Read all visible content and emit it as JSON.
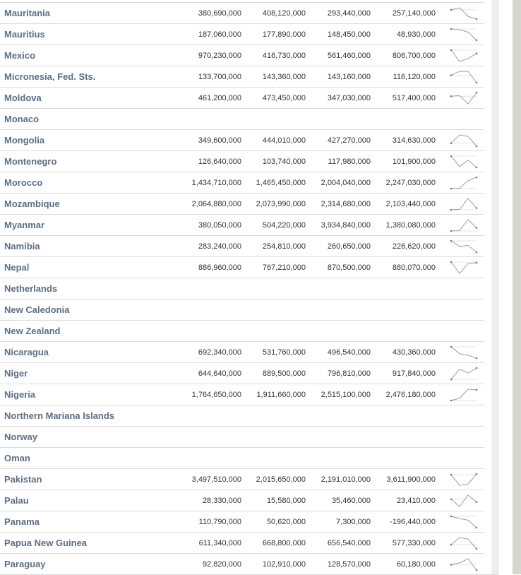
{
  "table": {
    "rows": [
      {
        "name": "Mauritania",
        "values": [
          "380,690,000",
          "408,120,000",
          "293,440,000",
          "257,140,000"
        ],
        "trend": [
          380690000,
          408120000,
          293440000,
          257140000
        ]
      },
      {
        "name": "Mauritius",
        "values": [
          "187,060,000",
          "177,890,000",
          "148,450,000",
          "48,930,000"
        ],
        "trend": [
          187060000,
          177890000,
          148450000,
          48930000
        ]
      },
      {
        "name": "Mexico",
        "values": [
          "970,230,000",
          "416,730,000",
          "561,460,000",
          "806,700,000"
        ],
        "trend": [
          970230000,
          416730000,
          561460000,
          806700000
        ]
      },
      {
        "name": "Micronesia, Fed. Sts.",
        "values": [
          "133,700,000",
          "143,360,000",
          "143,160,000",
          "116,120,000"
        ],
        "trend": [
          133700000,
          143360000,
          143160000,
          116120000
        ]
      },
      {
        "name": "Moldova",
        "values": [
          "461,200,000",
          "473,450,000",
          "347,030,000",
          "517,400,000"
        ],
        "trend": [
          461200000,
          473450000,
          347030000,
          517400000
        ]
      },
      {
        "name": "Monaco",
        "values": [
          "",
          "",
          "",
          ""
        ],
        "trend": []
      },
      {
        "name": "Mongolia",
        "values": [
          "349,600,000",
          "444,010,000",
          "427,270,000",
          "314,630,000"
        ],
        "trend": [
          349600000,
          444010000,
          427270000,
          314630000
        ]
      },
      {
        "name": "Montenegro",
        "values": [
          "126,640,000",
          "103,740,000",
          "117,980,000",
          "101,900,000"
        ],
        "trend": [
          126640000,
          103740000,
          117980000,
          101900000
        ]
      },
      {
        "name": "Morocco",
        "values": [
          "1,434,710,000",
          "1,465,450,000",
          "2,004,040,000",
          "2,247,030,000"
        ],
        "trend": [
          1434710000,
          1465450000,
          2004040000,
          2247030000
        ]
      },
      {
        "name": "Mozambique",
        "values": [
          "2,064,880,000",
          "2,073,990,000",
          "2,314,680,000",
          "2,103,440,000"
        ],
        "trend": [
          2064880000,
          2073990000,
          2314680000,
          2103440000
        ]
      },
      {
        "name": "Myanmar",
        "values": [
          "380,050,000",
          "504,220,000",
          "3,934,840,000",
          "1,380,080,000"
        ],
        "trend": [
          380050000,
          504220000,
          3934840000,
          1380080000
        ]
      },
      {
        "name": "Namibia",
        "values": [
          "283,240,000",
          "254,810,000",
          "260,650,000",
          "226,620,000"
        ],
        "trend": [
          283240000,
          254810000,
          260650000,
          226620000
        ]
      },
      {
        "name": "Nepal",
        "values": [
          "886,960,000",
          "767,210,000",
          "870,500,000",
          "880,070,000"
        ],
        "trend": [
          886960000,
          767210000,
          870500000,
          880070000
        ]
      },
      {
        "name": "Netherlands",
        "values": [
          "",
          "",
          "",
          ""
        ],
        "trend": []
      },
      {
        "name": "New Caledonia",
        "values": [
          "",
          "",
          "",
          ""
        ],
        "trend": []
      },
      {
        "name": "New Zealand",
        "values": [
          "",
          "",
          "",
          ""
        ],
        "trend": []
      },
      {
        "name": "Nicaragua",
        "values": [
          "692,340,000",
          "531,760,000",
          "496,540,000",
          "430,360,000"
        ],
        "trend": [
          692340000,
          531760000,
          496540000,
          430360000
        ]
      },
      {
        "name": "Niger",
        "values": [
          "644,640,000",
          "889,500,000",
          "796,810,000",
          "917,840,000"
        ],
        "trend": [
          644640000,
          889500000,
          796810000,
          917840000
        ]
      },
      {
        "name": "Nigeria",
        "values": [
          "1,764,650,000",
          "1,911,660,000",
          "2,515,100,000",
          "2,476,180,000"
        ],
        "trend": [
          1764650000,
          1911660000,
          2515100000,
          2476180000
        ]
      },
      {
        "name": "Northern Mariana Islands",
        "values": [
          "",
          "",
          "",
          ""
        ],
        "trend": []
      },
      {
        "name": "Norway",
        "values": [
          "",
          "",
          "",
          ""
        ],
        "trend": []
      },
      {
        "name": "Oman",
        "values": [
          "",
          "",
          "",
          ""
        ],
        "trend": []
      },
      {
        "name": "Pakistan",
        "values": [
          "3,497,510,000",
          "2,015,650,000",
          "2,191,010,000",
          "3,611,900,000"
        ],
        "trend": [
          3497510000,
          2015650000,
          2191010000,
          3611900000
        ]
      },
      {
        "name": "Palau",
        "values": [
          "28,330,000",
          "15,580,000",
          "35,460,000",
          "23,410,000"
        ],
        "trend": [
          28330000,
          15580000,
          35460000,
          23410000
        ]
      },
      {
        "name": "Panama",
        "values": [
          "110,790,000",
          "50,620,000",
          "7,300,000",
          "-196,440,000"
        ],
        "trend": [
          110790000,
          50620000,
          7300000,
          -196440000
        ]
      },
      {
        "name": "Papua New Guinea",
        "values": [
          "611,340,000",
          "668,800,000",
          "656,540,000",
          "577,330,000"
        ],
        "trend": [
          611340000,
          668800000,
          656540000,
          577330000
        ]
      },
      {
        "name": "Paraguay",
        "values": [
          "92,820,000",
          "102,910,000",
          "128,570,000",
          "60,180,000"
        ],
        "trend": [
          92820000,
          102910000,
          128570000,
          60180000
        ]
      }
    ]
  },
  "colors": {
    "name_text": "#5e6e83",
    "number_text": "#333333",
    "row_border": "#dcdcdc",
    "spark_line": "#9a9ea6",
    "spark_ref": "#e4e4e4",
    "spark_dot": "#5b7fb0"
  }
}
